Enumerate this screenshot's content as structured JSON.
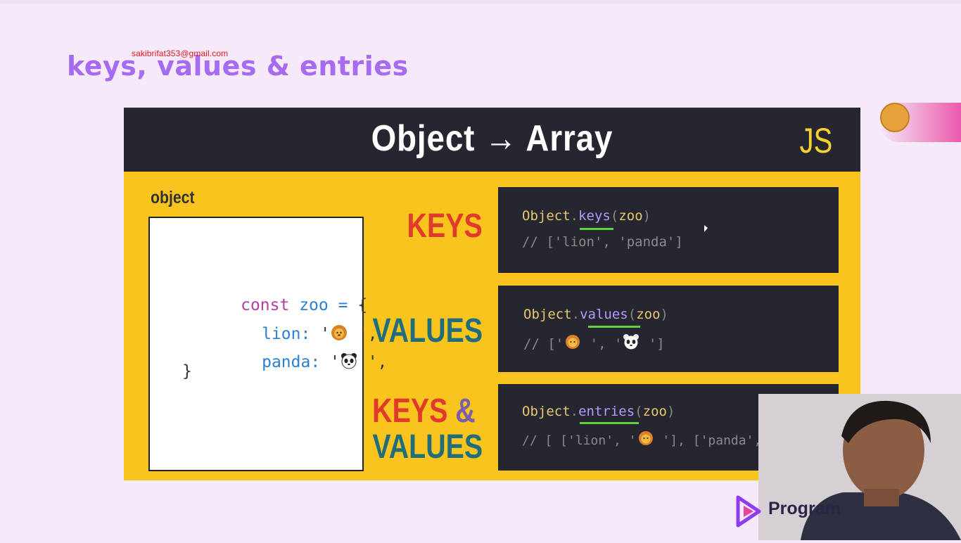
{
  "watermark": {
    "email": "sakibrifat353@gmail.com"
  },
  "slide": {
    "title": "keys, values & entries",
    "header": {
      "title": "Object → Array",
      "badge": "JS"
    },
    "object_label": "object",
    "code": {
      "line1_kw": "const",
      "line1_var": "zoo",
      "line1_op": "=",
      "line1_brace": "{",
      "line2_key": "lion:",
      "line2_open": " '",
      "line2_close": " ',",
      "line3_key": "panda:",
      "line3_open": " '",
      "line3_close": " ',",
      "line4": "}"
    },
    "methods": [
      {
        "label": "KEYS",
        "code": "Object.keys(zoo)",
        "result": "// ['lion', 'panda']"
      },
      {
        "label": "VALUES",
        "code": "Object.values(zoo)",
        "result_prefix": "// ['",
        "result_mid": " ', '",
        "result_suffix": " ']"
      },
      {
        "label_line1": "KEYS",
        "label_amp": "&",
        "label_line2": "VALUES",
        "code": "Object.entries(zoo)",
        "result_prefix": "// [ ['lion', '",
        "result_mid": " '], ['panda', '",
        "result_suffix": " ']"
      }
    ]
  },
  "brand": {
    "name": "Program"
  },
  "colors": {
    "slide_bg": "#fac41f",
    "panel_bg": "#25262f",
    "title_purple": "#a66bf0",
    "label_red": "#e03a2c",
    "label_teal": "#216d7c",
    "underline_green": "#5fd33c",
    "method_purple": "#b39cff"
  },
  "icons": [
    "lion-emoji-icon",
    "panda-emoji-icon",
    "cookie-meteor-icon",
    "brand-logo-icon",
    "cursor-icon"
  ]
}
